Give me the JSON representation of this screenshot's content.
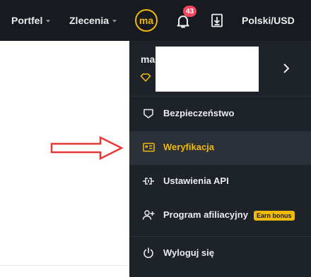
{
  "topbar": {
    "portfel_label": "Portfel",
    "zlecenia_label": "Zlecenia",
    "avatar_initials": "ma",
    "notification_count": "43",
    "language_label": "Polski/USD"
  },
  "profile": {
    "name_prefix": "ma"
  },
  "menu": {
    "items": [
      {
        "label": "Bezpieczeństwo",
        "icon": "shield-icon"
      },
      {
        "label": "Weryfikacja",
        "icon": "id-card-icon"
      },
      {
        "label": "Ustawienia API",
        "icon": "api-icon"
      },
      {
        "label": "Program afiliacyjny",
        "icon": "add-user-icon",
        "badge": "Earn bonus"
      },
      {
        "label": "Wyloguj się",
        "icon": "power-icon"
      }
    ]
  },
  "colors": {
    "accent": "#f0b90b",
    "topbar_bg": "#181a20",
    "panel_bg": "#1e2329",
    "highlight_bg": "#2b3139",
    "badge_red": "#f6465d",
    "annotation_arrow": "#e53935"
  }
}
